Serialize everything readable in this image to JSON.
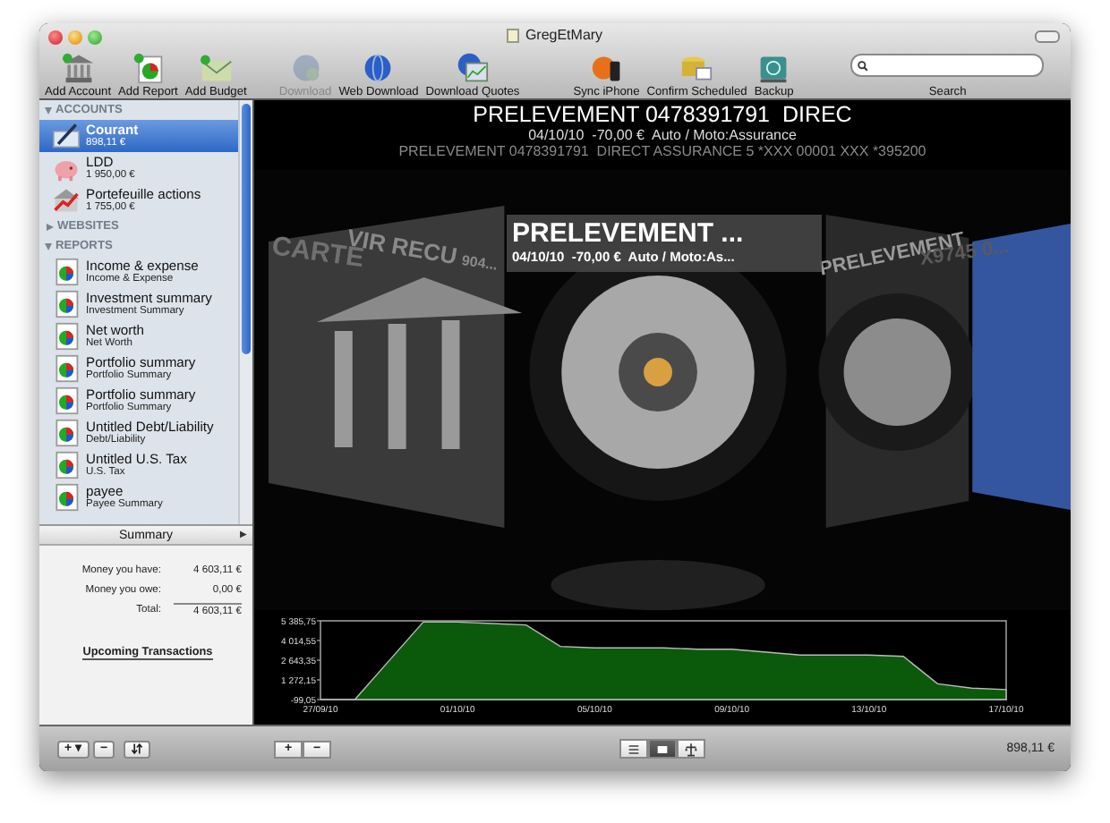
{
  "window": {
    "title": "GregEtMary"
  },
  "toolbar": {
    "items": [
      {
        "label": "Add Account",
        "disabled": false
      },
      {
        "label": "Add Report",
        "disabled": false
      },
      {
        "label": "Add Budget",
        "disabled": false
      },
      {
        "label": "Download",
        "disabled": true
      },
      {
        "label": "Web Download",
        "disabled": false
      },
      {
        "label": "Download Quotes",
        "disabled": false
      },
      {
        "label": "Sync iPhone",
        "disabled": false
      },
      {
        "label": "Confirm Scheduled",
        "disabled": false
      },
      {
        "label": "Backup",
        "disabled": false
      }
    ],
    "search": {
      "label": "Search"
    }
  },
  "sidebar": {
    "sections": [
      {
        "title": "ACCOUNTS",
        "expanded": true,
        "items": [
          {
            "name": "Courant",
            "detail": "898,11 €",
            "selected": true
          },
          {
            "name": "LDD",
            "detail": "1 950,00 €",
            "selected": false
          },
          {
            "name": "Portefeuille actions",
            "detail": "1 755,00 €",
            "selected": false
          }
        ]
      },
      {
        "title": "WEBSITES",
        "expanded": false
      },
      {
        "title": "REPORTS",
        "expanded": true,
        "items": [
          {
            "name": "Income & expense",
            "detail": "Income & Expense",
            "selected": false
          },
          {
            "name": "Investment summary",
            "detail": "Investment Summary",
            "selected": false
          },
          {
            "name": "Net worth",
            "detail": "Net Worth",
            "selected": false
          },
          {
            "name": "Portfolio summary",
            "detail": "Portfolio Summary",
            "selected": false
          },
          {
            "name": "Portfolio summary",
            "detail": "Portfolio Summary",
            "selected": false
          },
          {
            "name": "Untitled Debt/Liability",
            "detail": "Debt/Liability",
            "selected": false
          },
          {
            "name": "Untitled U.S. Tax",
            "detail": "U.S. Tax",
            "selected": false
          },
          {
            "name": "payee",
            "detail": "Payee Summary",
            "selected": false
          }
        ]
      }
    ]
  },
  "summary": {
    "title": "Summary",
    "toggle": "▶",
    "rows": [
      {
        "label": "Money you have:",
        "value": "4 603,11 €"
      },
      {
        "label": "Money you owe:",
        "value": "0,00 €"
      },
      {
        "label": "Total:",
        "value": "4 603,11 €"
      }
    ],
    "link": "Upcoming Transactions"
  },
  "transaction": {
    "title": "PRELEVEMENT 0478391791  DIREC",
    "details": "04/10/10  -70,00 €  Auto / Moto:Assurance",
    "memo": "PRELEVEMENT 0478391791  DIRECT ASSURANCE 5 *XXX 00001 XXX *395200"
  },
  "cover_flow": {
    "current": {
      "title": "PRELEVEMENT ...",
      "details": "04/10/10  -70,00 €  Auto / Moto:As..."
    },
    "side_titles": [
      "CARTE",
      "VIR RECU",
      "904...",
      "PRELEVEMENT",
      "X9745 0..."
    ]
  },
  "chart_data": {
    "type": "area",
    "categories": [
      "27/09/10",
      null,
      null,
      null,
      "01/10/10",
      null,
      null,
      null,
      "05/10/10",
      null,
      null,
      null,
      "09/10/10",
      null,
      null,
      null,
      "13/10/10",
      null,
      null,
      null,
      "17/10/10"
    ],
    "series": [
      {
        "color": "#0b5a0b",
        "values": [
          -99,
          -99,
          2600,
          5300,
          5300,
          5200,
          5100,
          3600,
          3500,
          3500,
          3500,
          3400,
          3400,
          3200,
          3000,
          3000,
          3000,
          2900,
          1000,
          700,
          600
        ]
      }
    ],
    "ylim": [
      -99.05,
      5385.75
    ],
    "yticks": [
      {
        "value": -99.05,
        "label": "-99,05"
      },
      {
        "value": 1272.15,
        "label": "1 272,15"
      },
      {
        "value": 2643.35,
        "label": "2 643,35"
      },
      {
        "value": 4014.55,
        "label": "4 014,55"
      },
      {
        "value": 5385.75,
        "label": "5 385,75"
      }
    ]
  },
  "sidebar_buttons": [
    "+ ▾",
    "−"
  ],
  "main_buttons": [
    "+",
    "−"
  ],
  "bottom_bar": {
    "view_modes": [
      {
        "selected": false
      },
      {
        "selected": true
      },
      {
        "selected": false
      }
    ],
    "balance": "898,11 €"
  }
}
